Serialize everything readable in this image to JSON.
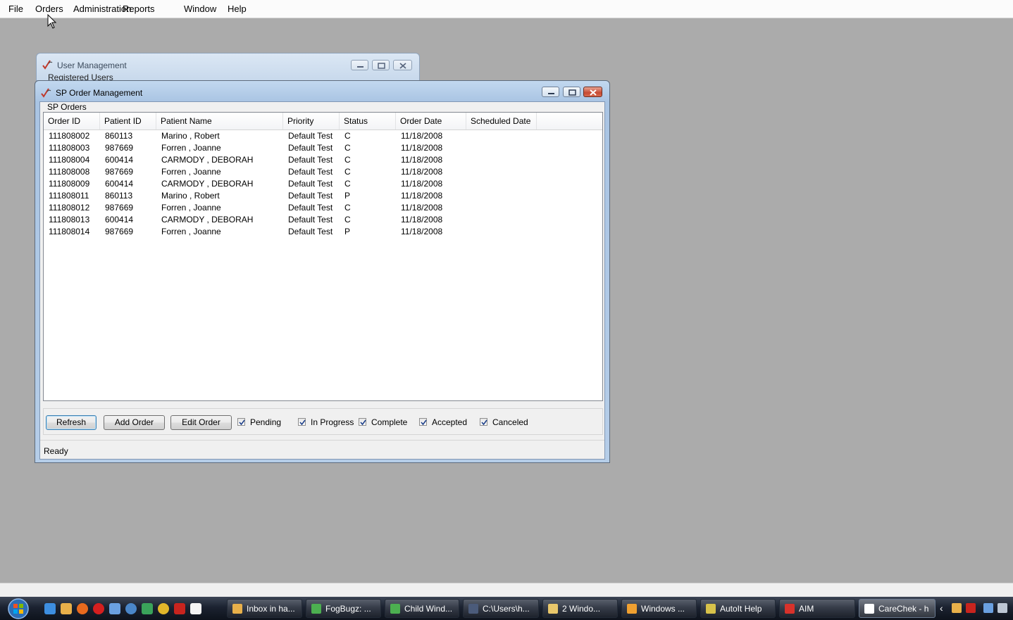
{
  "menubar": {
    "items": [
      "File",
      "Orders",
      "Administration",
      "Reports",
      "Window",
      "Help"
    ]
  },
  "background_window": {
    "title": "User Management",
    "sub_label": "Registered Users"
  },
  "main_window": {
    "title": "SP Order Management",
    "group_label": "SP Orders",
    "columns": [
      "Order ID",
      "Patient ID",
      "Patient Name",
      "Priority",
      "Status",
      "Order Date",
      "Scheduled Date"
    ],
    "rows": [
      [
        "111808002",
        "860113",
        "Marino , Robert",
        "Default Test",
        "C",
        "11/18/2008",
        ""
      ],
      [
        "111808003",
        "987669",
        "Forren , Joanne",
        "Default Test",
        "C",
        "11/18/2008",
        ""
      ],
      [
        "111808004",
        "600414",
        "CARMODY , DEBORAH",
        "Default Test",
        "C",
        "11/18/2008",
        ""
      ],
      [
        "111808008",
        "987669",
        "Forren , Joanne",
        "Default Test",
        "C",
        "11/18/2008",
        ""
      ],
      [
        "111808009",
        "600414",
        "CARMODY , DEBORAH",
        "Default Test",
        "C",
        "11/18/2008",
        ""
      ],
      [
        "111808011",
        "860113",
        "Marino , Robert",
        "Default Test",
        "P",
        "11/18/2008",
        ""
      ],
      [
        "111808012",
        "987669",
        "Forren , Joanne",
        "Default Test",
        "C",
        "11/18/2008",
        ""
      ],
      [
        "111808013",
        "600414",
        "CARMODY , DEBORAH",
        "Default Test",
        "C",
        "11/18/2008",
        ""
      ],
      [
        "111808014",
        "987669",
        "Forren , Joanne",
        "Default Test",
        "P",
        "11/18/2008",
        ""
      ]
    ],
    "buttons": {
      "refresh": "Refresh",
      "add_order": "Add Order",
      "edit_order": "Edit Order"
    },
    "filters": [
      {
        "label": "Pending",
        "checked": true
      },
      {
        "label": "In Progress",
        "checked": true
      },
      {
        "label": "Complete",
        "checked": true
      },
      {
        "label": "Accepted",
        "checked": true
      },
      {
        "label": "Canceled",
        "checked": true
      }
    ],
    "status": "Ready"
  },
  "taskbar": {
    "items": [
      {
        "label": "Inbox in ha...",
        "icon": "mail-icon",
        "color": "#e8b04a"
      },
      {
        "label": "FogBugz: ...",
        "icon": "browser-icon",
        "color": "#4caf50"
      },
      {
        "label": "Child Wind...",
        "icon": "browser-icon",
        "color": "#4caf50"
      },
      {
        "label": "C:\\Users\\h...",
        "icon": "console-icon",
        "color": "#4b5b7a"
      },
      {
        "label": "2 Windo...",
        "icon": "folder-icon",
        "color": "#e9c76b"
      },
      {
        "label": "Windows ...",
        "icon": "media-icon",
        "color": "#f0a030"
      },
      {
        "label": "AutoIt Help",
        "icon": "help-icon",
        "color": "#d7c24a"
      },
      {
        "label": "AIM",
        "icon": "aim-icon",
        "color": "#d8322b"
      },
      {
        "label": "CareChek - h",
        "icon": "carechek-icon",
        "color": "#ffffff"
      }
    ],
    "accent": "#1b2230"
  }
}
